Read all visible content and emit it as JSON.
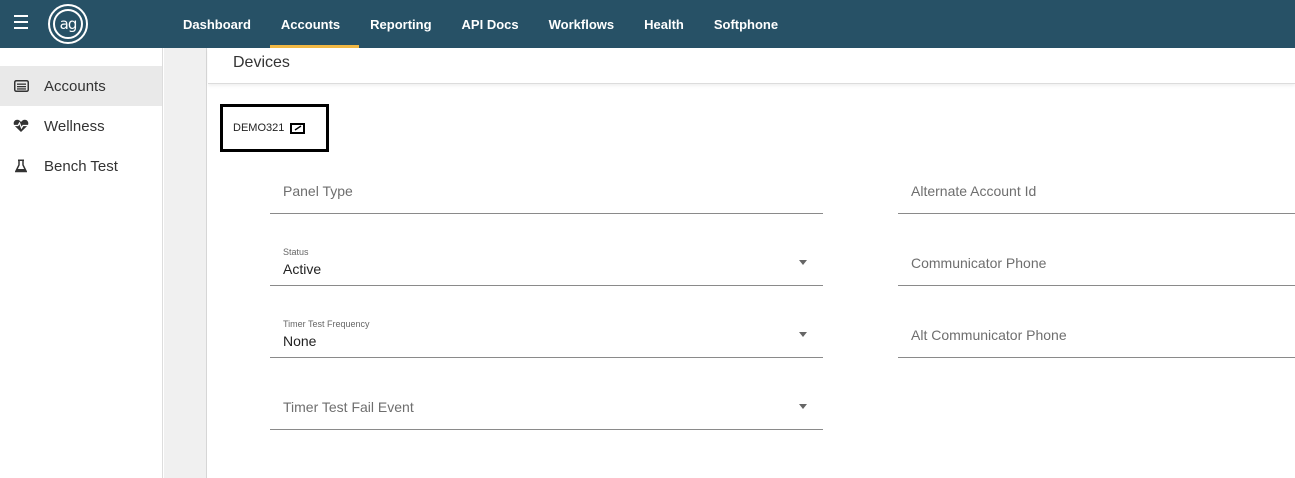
{
  "app": {
    "logo_text": "ag",
    "nav": [
      "Dashboard",
      "Accounts",
      "Reporting",
      "API Docs",
      "Workflows",
      "Health",
      "Softphone"
    ],
    "active_nav": "Accounts"
  },
  "sidebar": {
    "items": [
      {
        "label": "Accounts",
        "icon": "list-icon",
        "active": true
      },
      {
        "label": "Wellness",
        "icon": "heart-pulse-icon",
        "active": false
      },
      {
        "label": "Bench Test",
        "icon": "flask-icon",
        "active": false
      }
    ]
  },
  "page": {
    "title": "Devices",
    "account_id": "DEMO321"
  },
  "form": {
    "panel_type": {
      "placeholder": "Panel Type"
    },
    "status": {
      "label": "Status",
      "value": "Active"
    },
    "timer_test_frequency": {
      "label": "Timer Test Frequency",
      "value": "None"
    },
    "timer_test_fail_event": {
      "placeholder": "Timer Test Fail Event"
    },
    "alternate_account_id": {
      "placeholder": "Alternate Account Id"
    },
    "communicator_phone": {
      "placeholder": "Communicator Phone"
    },
    "alt_communicator_phone": {
      "placeholder": "Alt Communicator Phone"
    }
  },
  "colors": {
    "topbar": "#275166",
    "active_underline": "#f1b844"
  }
}
